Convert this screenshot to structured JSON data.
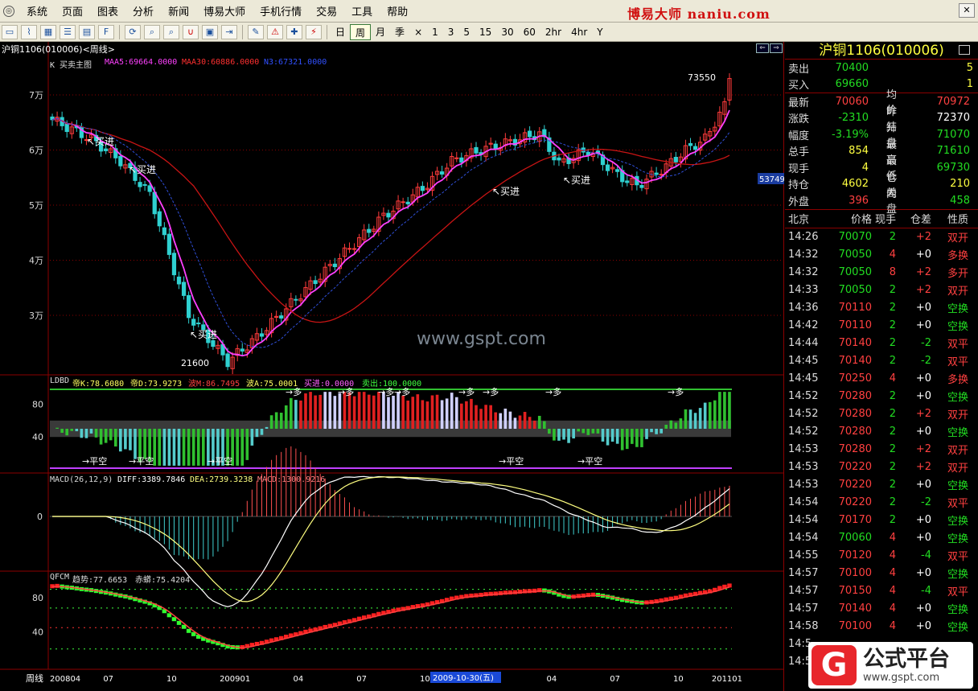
{
  "menu": {
    "items": [
      "系统",
      "页面",
      "图表",
      "分析",
      "新闻",
      "博易大师",
      "手机行情",
      "交易",
      "工具",
      "帮助"
    ],
    "brand": "博易大师 naniu.com"
  },
  "toolbar": {
    "periods": [
      "日",
      "周",
      "月",
      "季",
      "×",
      "1",
      "3",
      "5",
      "15",
      "30",
      "60",
      "2hr",
      "4hr",
      "Y"
    ],
    "active_period": "周"
  },
  "chart": {
    "header": "沪铜1106(010006)<周线>",
    "main_label": "K  买卖主图",
    "maa5": "MAA5:69664.0000",
    "maa30": "MAA30:60886.0000",
    "n3": "N3:67321.0000",
    "y_ticks": [
      "7万",
      "6万",
      "5万",
      "4万",
      "3万"
    ],
    "high_label": "73550",
    "low_label": "21600",
    "price_tag": "53749",
    "buy_signal": "买进",
    "watermark": "www.gspt.com",
    "ldbd": {
      "name": "LDBD",
      "dk": "帝K:78.6080",
      "dd": "帝D:73.9273",
      "bm": "波M:86.7495",
      "ba": "波A:75.0001",
      "buy": "买进:0.0000",
      "sell": "卖出:100.0000",
      "ticks": [
        "80",
        "40"
      ],
      "long_label": "→多",
      "flat_short": "→平空"
    },
    "macd": {
      "name": "MACD(26,12,9)",
      "diff": "DIFF:3389.7846",
      "dea": "DEA:2739.3238",
      "macd": "MACD:1300.9216",
      "ticks": [
        "0"
      ]
    },
    "qfcm": {
      "name": "QFCM",
      "trend": "趋势:77.6653",
      "dragon": "赤蟒:75.4204",
      "ticks": [
        "80",
        "40"
      ]
    },
    "x_axis": {
      "label": "周线",
      "ticks": [
        "200804",
        "07",
        "10",
        "200901",
        "04",
        "07",
        "10",
        "04",
        "07",
        "10",
        "201101"
      ],
      "cursor_date": "2009-10-30(五)"
    }
  },
  "quote": {
    "title": "沪铜1106(010006)",
    "sell": {
      "label": "卖出",
      "price": "70400",
      "vol": "5"
    },
    "buy": {
      "label": "买入",
      "price": "69660",
      "vol": "1"
    },
    "stats": [
      {
        "l1": "最新",
        "v1": "70060",
        "c1": "red",
        "l2": "均价",
        "v2": "70972",
        "c2": "red"
      },
      {
        "l1": "涨跌",
        "v1": "-2310",
        "c1": "green",
        "l2": "昨结",
        "v2": "72370",
        "c2": "white"
      },
      {
        "l1": "幅度",
        "v1": "-3.19%",
        "c1": "green",
        "l2": "开盘",
        "v2": "71070",
        "c2": "green"
      },
      {
        "l1": "总手",
        "v1": "854",
        "c1": "yellow",
        "l2": "最高",
        "v2": "71610",
        "c2": "green"
      },
      {
        "l1": "现手",
        "v1": "4",
        "c1": "yellow",
        "l2": "最低",
        "v2": "69730",
        "c2": "green"
      },
      {
        "l1": "持仓",
        "v1": "4602",
        "c1": "yellow",
        "l2": "仓差",
        "v2": "210",
        "c2": "yellow"
      },
      {
        "l1": "外盘",
        "v1": "396",
        "c1": "red",
        "l2": "内盘",
        "v2": "458",
        "c2": "green"
      }
    ],
    "trade_header": [
      "北京",
      "价格",
      "现手",
      "仓差",
      "性质"
    ],
    "trades": [
      [
        "14:26",
        "70070",
        "2",
        "+2",
        "双开"
      ],
      [
        "14:32",
        "70050",
        "4",
        "+0",
        "多换"
      ],
      [
        "14:32",
        "70050",
        "8",
        "+2",
        "多开"
      ],
      [
        "14:33",
        "70050",
        "2",
        "+2",
        "双开"
      ],
      [
        "14:36",
        "70110",
        "2",
        "+0",
        "空换"
      ],
      [
        "14:42",
        "70110",
        "2",
        "+0",
        "空换"
      ],
      [
        "14:44",
        "70140",
        "2",
        "-2",
        "双平"
      ],
      [
        "14:45",
        "70140",
        "2",
        "-2",
        "双平"
      ],
      [
        "14:45",
        "70250",
        "4",
        "+0",
        "多换"
      ],
      [
        "14:52",
        "70280",
        "2",
        "+0",
        "空换"
      ],
      [
        "14:52",
        "70280",
        "2",
        "+2",
        "双开"
      ],
      [
        "14:52",
        "70280",
        "2",
        "+0",
        "空换"
      ],
      [
        "14:53",
        "70280",
        "2",
        "+2",
        "双开"
      ],
      [
        "14:53",
        "70220",
        "2",
        "+2",
        "双开"
      ],
      [
        "14:53",
        "70220",
        "2",
        "+0",
        "空换"
      ],
      [
        "14:54",
        "70220",
        "2",
        "-2",
        "双平"
      ],
      [
        "14:54",
        "70170",
        "2",
        "+0",
        "空换"
      ],
      [
        "14:54",
        "70060",
        "4",
        "+0",
        "空换"
      ],
      [
        "14:55",
        "70120",
        "4",
        "-4",
        "双平"
      ],
      [
        "14:57",
        "70100",
        "4",
        "+0",
        "空换"
      ],
      [
        "14:57",
        "70150",
        "4",
        "-4",
        "双平"
      ],
      [
        "14:57",
        "70140",
        "4",
        "+0",
        "空换"
      ],
      [
        "14:58",
        "70100",
        "4",
        "+0",
        "空换"
      ],
      [
        "14:5",
        "",
        "",
        "",
        ""
      ],
      [
        "14:5",
        "",
        "",
        "",
        ""
      ]
    ]
  },
  "logo": {
    "text": "公式平台",
    "sub": "www.gspt.com",
    "glyph": "G"
  },
  "colors": {
    "up": "#ff3b3b",
    "down": "#2fd0d0",
    "ma5": "#ff40ff",
    "ma30": "#c81414",
    "n3": "#2f4fd8",
    "grid": "#8b0000"
  }
}
